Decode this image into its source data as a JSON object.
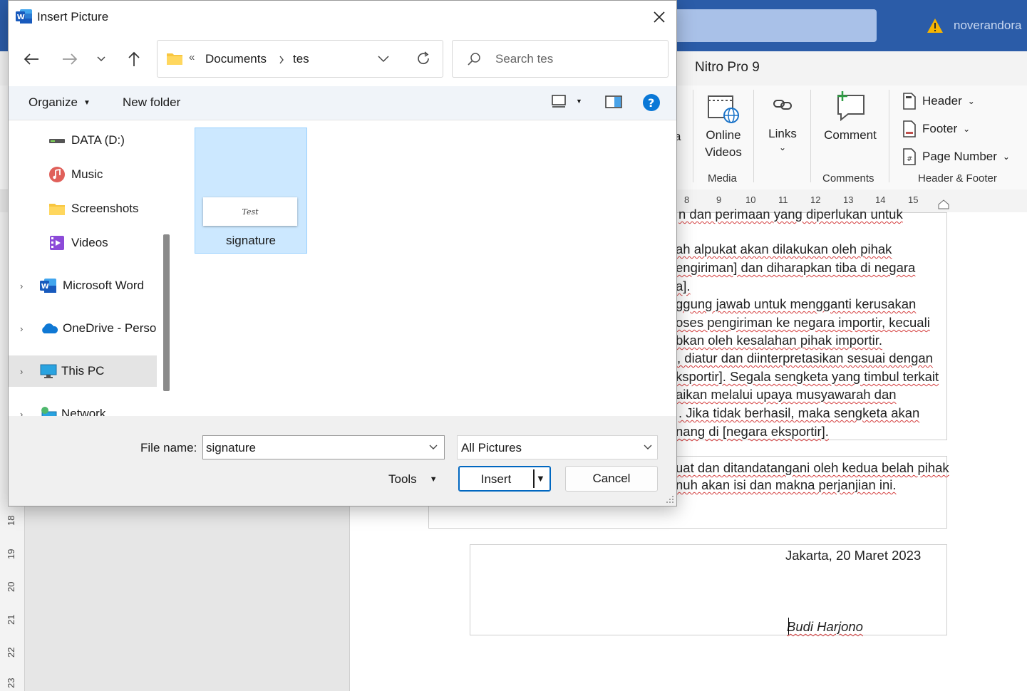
{
  "dialog": {
    "title": "Insert Picture",
    "breadcrumb": {
      "overflow": "«",
      "items": [
        "Documents",
        "tes"
      ]
    },
    "search_placeholder": "Search tes",
    "toolbar": {
      "organize_label": "Organize",
      "new_folder_label": "New folder"
    },
    "nav_items": [
      {
        "label": "DATA (D:)",
        "icon": "drive-icon"
      },
      {
        "label": "Music",
        "icon": "music-icon"
      },
      {
        "label": "Screenshots",
        "icon": "folder-icon"
      },
      {
        "label": "Videos",
        "icon": "videos-icon"
      },
      {
        "label": "Microsoft Word",
        "icon": "word-icon"
      },
      {
        "label": "OneDrive - Perso",
        "icon": "onedrive-icon"
      },
      {
        "label": "This PC",
        "icon": "pc-icon",
        "selected": true
      },
      {
        "label": "Network",
        "icon": "network-icon"
      }
    ],
    "files": [
      {
        "name": "signature",
        "thumb_text": "Test",
        "selected": true
      }
    ],
    "file_name_label": "File name:",
    "file_name_value": "signature",
    "file_type_value": "All Pictures",
    "tools_label": "Tools",
    "insert_label": "Insert",
    "cancel_label": "Cancel"
  },
  "word": {
    "user_name": "noverandora",
    "tab_label": "Nitro Pro 9",
    "ribbon": {
      "partial_label": "a",
      "online_videos_line1": "Online",
      "online_videos_line2": "Videos",
      "media_group": "Media",
      "links_label": "Links",
      "comment_label": "Comment",
      "comments_group": "Comments",
      "header_label": "Header",
      "footer_label": "Footer",
      "page_number_label": "Page Number",
      "header_footer_group": "Header & Footer"
    },
    "ruler_numbers": [
      "8",
      "9",
      "10",
      "11",
      "12",
      "13",
      "14",
      "15"
    ],
    "vertical_ruler_numbers": [
      "18",
      "19",
      "20",
      "21",
      "22",
      "23"
    ],
    "doc_lines": [
      "n dan perimaan yang diperlukan untuk",
      "ah alpukat akan dilakukan oleh pihak",
      "engiriman] dan diharapkan tiba di negara",
      "a].",
      "ggung jawab untuk mengganti kerusakan",
      "oses pengiriman ke negara importir, kecuali",
      "bkan oleh kesalahan pihak importir.",
      ", diatur dan diinterpretasikan sesuai dengan",
      "ksportir]. Segala sengketa yang timbul terkait",
      "aikan melalui upaya musyawarah dan",
      ". Jika tidak berhasil, maka sengketa akan",
      "nang di [negara eksportir]."
    ],
    "doc_lines_2": [
      "uat dan ditandatangani oleh kedua belah pihak",
      "nuh akan isi dan makna perjanjian ini."
    ],
    "date_line": "Jakarta, 20 Maret 2023",
    "signer_name": "Budi Harjono"
  }
}
